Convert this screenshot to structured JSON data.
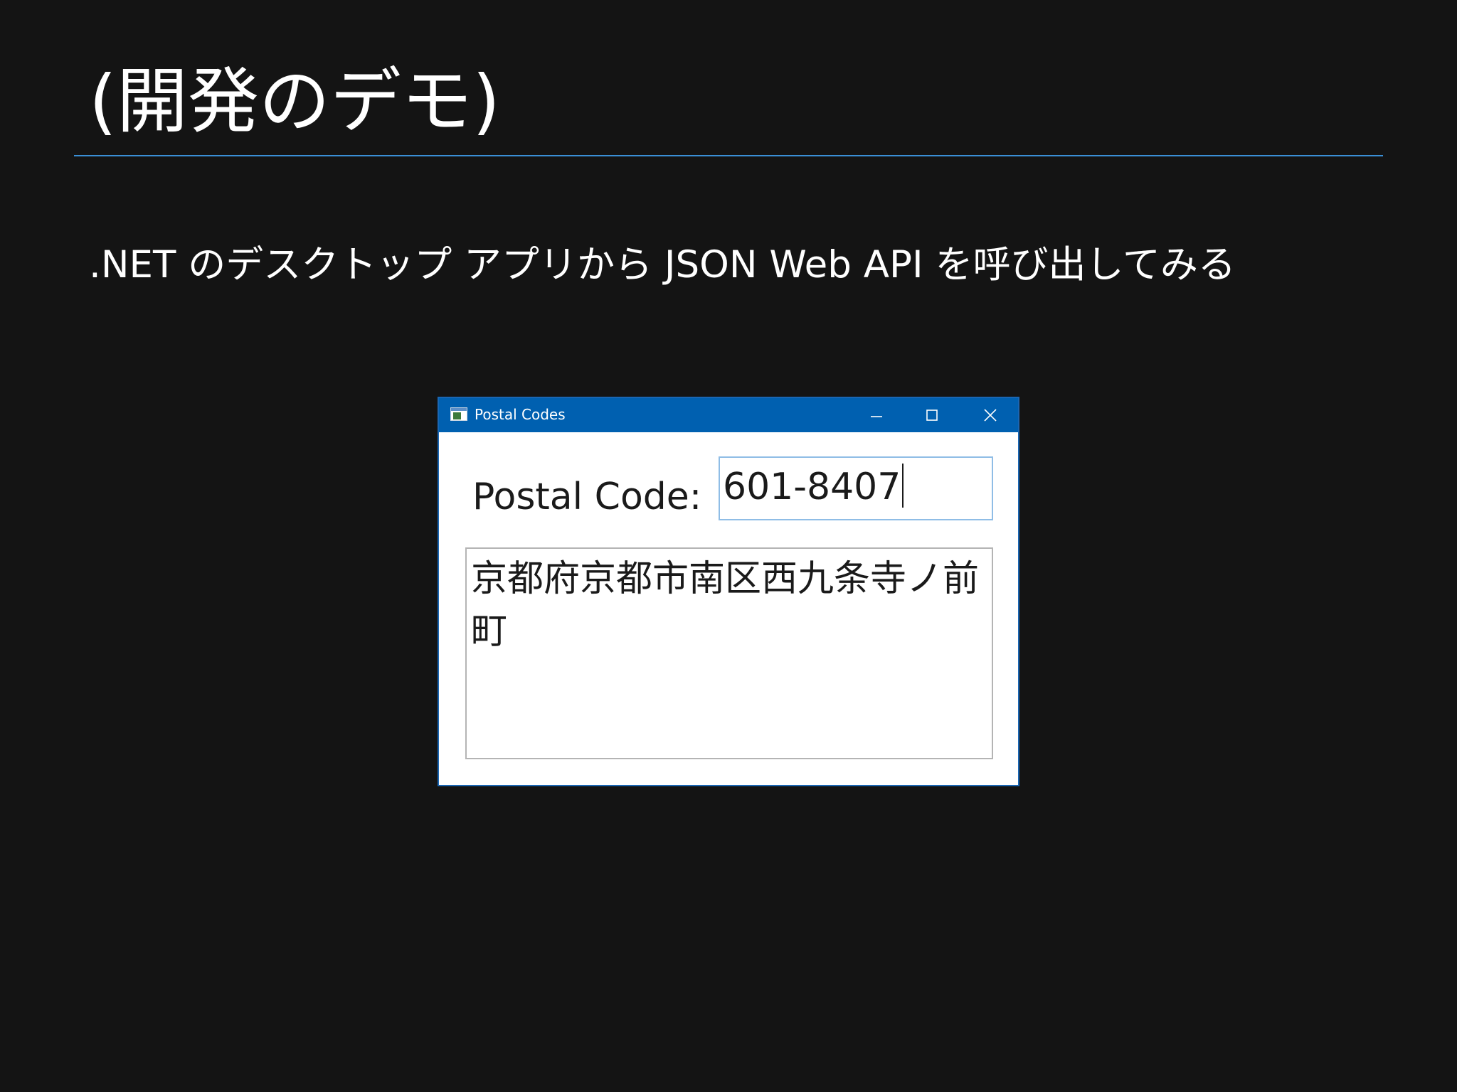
{
  "slide": {
    "title": "(開発のデモ)",
    "subtitle": ".NET のデスクトップ アプリから JSON Web API を呼び出してみる"
  },
  "window": {
    "title": "Postal Codes",
    "buttons": {
      "minimize": "minimize-icon",
      "maximize": "maximize-icon",
      "close": "close-icon"
    }
  },
  "form": {
    "postal_label": "Postal Code:",
    "postal_value": "601-8407",
    "address": "京都府京都市南区西九条寺ノ前町"
  },
  "colors": {
    "background": "#141414",
    "title_rule": "#3a8fd6",
    "titlebar": "#0060b0",
    "input_border": "#8fbde6"
  }
}
